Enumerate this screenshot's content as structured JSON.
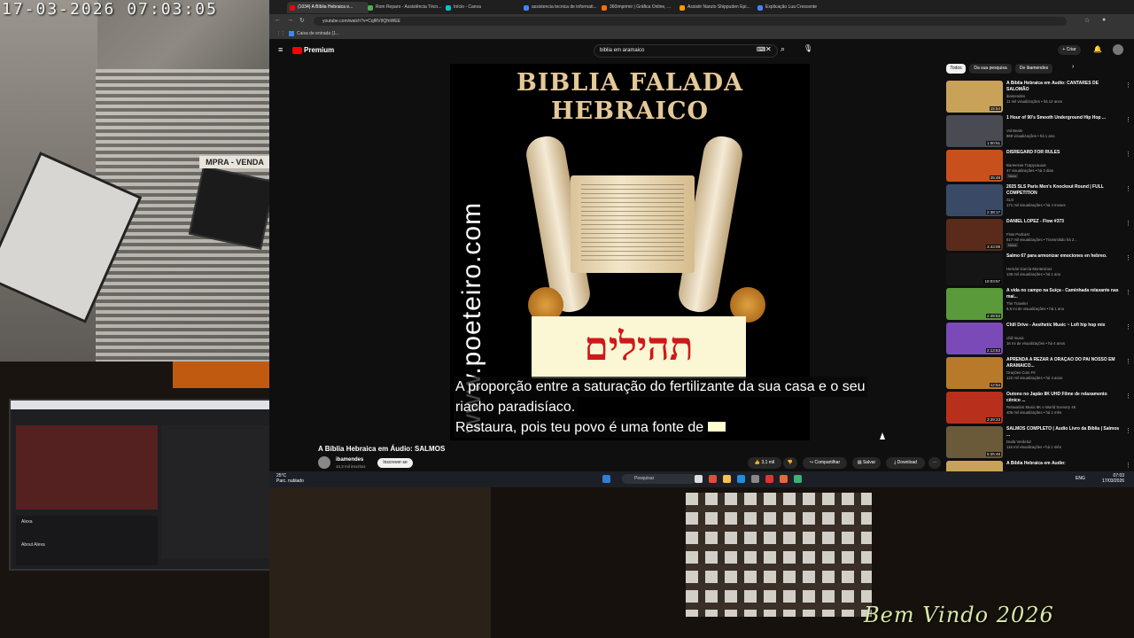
{
  "overlay": {
    "timestamp": "17-03-2026  07:03:05",
    "welcome": "Bem Vindo 2026",
    "shop_sign": "MPRA - VENDA"
  },
  "browser": {
    "tabs": [
      {
        "label": "(1034) A Bíblia Hebraica e...",
        "active": true,
        "color": "#ff0000"
      },
      {
        "label": "Rom Reparo - Assistência Técn...",
        "active": false,
        "color": "#4caf50"
      },
      {
        "label": "Início - Canva",
        "active": false,
        "color": "#00c4cc"
      },
      {
        "label": "assistencia tecnica de informati...",
        "active": false,
        "color": "#4285f4"
      },
      {
        "label": "360imprimir | Gráfica Online, ...",
        "active": false,
        "color": "#ff6f00"
      },
      {
        "label": "Assistir Naruto Shippuden Epi...",
        "active": false,
        "color": "#ff9800"
      },
      {
        "label": "Explicação Lua Crescente",
        "active": false,
        "color": "#4285f4"
      }
    ],
    "url": "youtube.com/watch?v=CqlRV9QfnWEE",
    "bookmark": "Caixa de entrada (1..."
  },
  "youtube": {
    "logo": "Premium",
    "search_query": "biblia em aramaico",
    "create_label": "+ Criar",
    "video": {
      "cover_title_line1": "BIBLIA FALADA",
      "cover_title_line2": "HEBRAICO",
      "watermark": "www.poeteiro.com",
      "hebrew_word": "תהילים",
      "caption_line1": "A proporção entre a saturação do fertilizante da sua casa e o seu",
      "caption_line2": "riacho paradisíaco.",
      "caption_line3": "Restaura, pois teu povo é uma fonte de"
    },
    "title": "A Bíblia Hebraica em Áudio: SALMOS",
    "channel": "ibamendes",
    "subscribers": "10,3 mil inscritos",
    "subscribe_label": "Inscrever-se",
    "likes": "3,1 mil",
    "share_label": "Compartilhar",
    "save_label": "Salvar",
    "download_label": "Download",
    "chips": [
      "Todos",
      "Da sua pesquisa",
      "De ibamendes"
    ],
    "suggestions": [
      {
        "title": "A Bíblia Hebraica em Áudio: CANTARES DE SALOMÃO",
        "channel": "ibamendes",
        "meta": "11 mil visualizações • há 12 anos",
        "duration": "15:54",
        "thumb": "#c9a25a",
        "badge": ""
      },
      {
        "title": "1 Hour of 90's Smooth Underground Hip Hop ...",
        "channel": "Vol Beats",
        "meta": "969 visualizações • há 1 ano",
        "duration": "1:00:51",
        "thumb": "#4a4a52",
        "badge": ""
      },
      {
        "title": "DISREGARD FOR RULES",
        "channel": "Валентин Тсарусашов",
        "meta": "47 visualizações • há 3 dias",
        "duration": "25:48",
        "thumb": "#c8501c",
        "badge": "Novo"
      },
      {
        "title": "2025 SLS Paris Men's Knockout Round | FULL COMPETITION",
        "channel": "SLS",
        "meta": "171 mil visualizações • há 4 meses",
        "duration": "2:38:17",
        "thumb": "#3a4a66",
        "badge": ""
      },
      {
        "title": "DANIEL LOPEZ - Flow #373",
        "channel": "Flow Podcast",
        "meta": "517 mil visualizações • Transmitido há 2...",
        "duration": "3:43:09",
        "thumb": "#5a2a1a",
        "badge": "Novo"
      },
      {
        "title": "Salmo 67 para armonizar emociones en hebreo.",
        "channel": "Hernán García Montesinos",
        "meta": "136 mil visualizações • há 1 ano",
        "duration": "10:03:57",
        "thumb": "#151515",
        "badge": ""
      },
      {
        "title": "A vida no campo na Suíça - Caminhada relaxante nas mai...",
        "channel": "The Traveler",
        "meta": "8,5 mi de visualizações • há 1 ano",
        "duration": "2:49:53",
        "thumb": "#5a9a3a",
        "badge": ""
      },
      {
        "title": "Chill Drive - Aesthetic Music ~ Lofi hip hop mix",
        "channel": "chill music",
        "meta": "16 mi de visualizações • há 4 anos",
        "duration": "2:13:53",
        "thumb": "#7a4ab8",
        "badge": ""
      },
      {
        "title": "APRENDA A REZAR A ORAÇÃO DO PAI NOSSO EM ARAMAICO...",
        "channel": "Orações Com Fé",
        "meta": "122 mil visualizações • há 4 anos",
        "duration": "12:54",
        "thumb": "#b87a2a",
        "badge": ""
      },
      {
        "title": "Outono no Japão 8K UHD Filme de relaxamento cênico ...",
        "channel": "Relaxation Music 8K e World Scenery 4K",
        "meta": "406 mil visualizações • há 1 mês",
        "duration": "3:29:23",
        "thumb": "#b8301c",
        "badge": ""
      },
      {
        "title": "SALMOS COMPLETO | Áudio Livro da Bíblia | Salmos ...",
        "channel": "Duda Verdeluz",
        "meta": "116 mil visualizações • há 1 mês",
        "duration": "5:25:48",
        "thumb": "#6a5a3a",
        "badge": ""
      },
      {
        "title": "A Bíblia Hebraica em Áudio:",
        "channel": "",
        "meta": "",
        "duration": "",
        "thumb": "#c9a25a",
        "badge": ""
      }
    ]
  },
  "taskbar": {
    "weather_temp": "25°C",
    "weather_desc": "Parc. nublado",
    "search_label": "Pesquisar",
    "lang": "ENG",
    "time": "07:03",
    "date": "17/03/2026"
  },
  "inner_monitor": {
    "user": "Alexa",
    "about": "About Alexa"
  }
}
